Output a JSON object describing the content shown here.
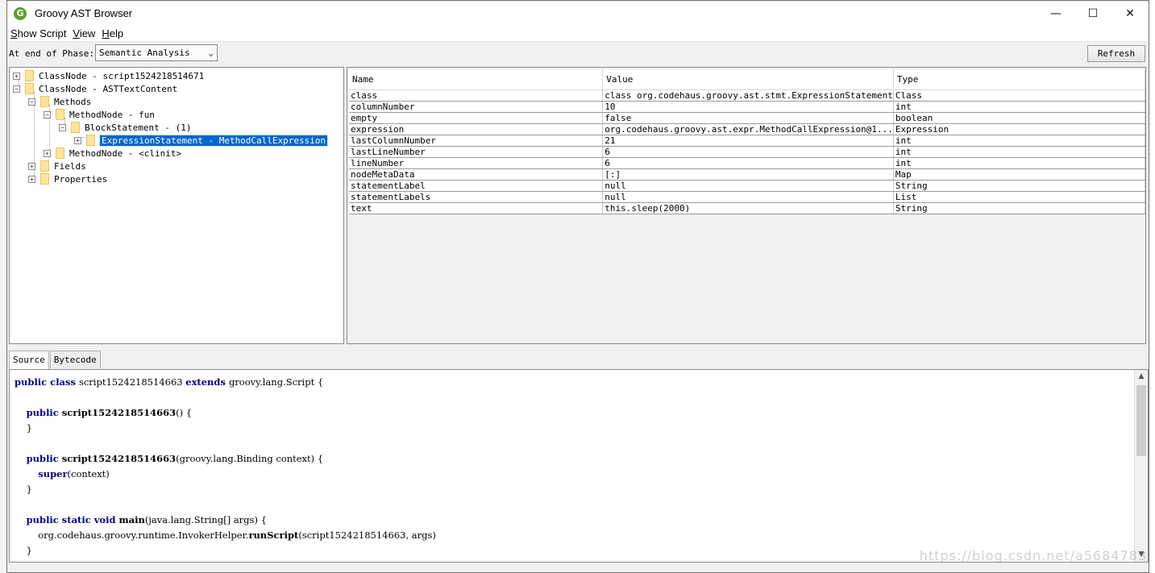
{
  "window": {
    "title": "Groovy AST Browser",
    "icon_letter": "G",
    "controls": {
      "minimize": "—",
      "maximize": "☐",
      "close": "✕"
    }
  },
  "menu": [
    {
      "mnemonic": "S",
      "rest": "how Script"
    },
    {
      "mnemonic": "V",
      "rest": "iew"
    },
    {
      "mnemonic": "H",
      "rest": "elp"
    }
  ],
  "toolbar": {
    "phase_label": "At end of Phase:",
    "phase_value": "Semantic Analysis",
    "refresh_label": "Refresh"
  },
  "tree": [
    {
      "label": "ClassNode - script1524218514671",
      "expander": "+",
      "depth": 0
    },
    {
      "label": "ClassNode - ASTTextContent",
      "expander": "−",
      "depth": 0
    },
    {
      "label": "Methods",
      "expander": "−",
      "depth": 1
    },
    {
      "label": "MethodNode - fun",
      "expander": "−",
      "depth": 2
    },
    {
      "label": "BlockStatement - (1)",
      "expander": "−",
      "depth": 3
    },
    {
      "label": "ExpressionStatement - MethodCallExpression",
      "expander": "+",
      "depth": 4,
      "selected": true
    },
    {
      "label": "MethodNode - <clinit>",
      "expander": "+",
      "depth": 2
    },
    {
      "label": "Fields",
      "expander": "+",
      "depth": 1
    },
    {
      "label": "Properties",
      "expander": "+",
      "depth": 1
    }
  ],
  "properties": {
    "headers": [
      "Name",
      "Value",
      "Type"
    ],
    "rows": [
      [
        "class",
        "class org.codehaus.groovy.ast.stmt.ExpressionStatement",
        "Class"
      ],
      [
        "columnNumber",
        "10",
        "int"
      ],
      [
        "empty",
        "false",
        "boolean"
      ],
      [
        "expression",
        "org.codehaus.groovy.ast.expr.MethodCallExpression@1...",
        "Expression"
      ],
      [
        "lastColumnNumber",
        "21",
        "int"
      ],
      [
        "lastLineNumber",
        "6",
        "int"
      ],
      [
        "lineNumber",
        "6",
        "int"
      ],
      [
        "nodeMetaData",
        "[:]",
        "Map"
      ],
      [
        "statementLabel",
        "null",
        "String"
      ],
      [
        "statementLabels",
        "null",
        "List"
      ],
      [
        "text",
        "this.sleep(2000)",
        "String"
      ]
    ]
  },
  "tabs": [
    "Source",
    "Bytecode"
  ],
  "source_lines": [
    [
      [
        "kw",
        "public class "
      ],
      [
        "t",
        "script1524218514663 "
      ],
      [
        "kw",
        "extends "
      ],
      [
        "t",
        "groovy.lang.Script {"
      ]
    ],
    [],
    [
      [
        "t",
        "    "
      ],
      [
        "kw",
        "public "
      ],
      [
        "fn",
        "script1524218514663"
      ],
      [
        "t",
        "() {"
      ]
    ],
    [
      [
        "t",
        "    }"
      ]
    ],
    [],
    [
      [
        "t",
        "    "
      ],
      [
        "kw",
        "public "
      ],
      [
        "fn",
        "script1524218514663"
      ],
      [
        "t",
        "(groovy.lang.Binding context) {"
      ]
    ],
    [
      [
        "t",
        "        "
      ],
      [
        "kw",
        "super"
      ],
      [
        "t",
        "(context)"
      ]
    ],
    [
      [
        "t",
        "    }"
      ]
    ],
    [],
    [
      [
        "t",
        "    "
      ],
      [
        "kw",
        "public static void "
      ],
      [
        "fn",
        "main"
      ],
      [
        "t",
        "(java.lang.String[] args) {"
      ]
    ],
    [
      [
        "t",
        "        org.codehaus.groovy.runtime.InvokerHelper."
      ],
      [
        "fn",
        "runScript"
      ],
      [
        "t",
        "(script1524218514663, args)"
      ]
    ],
    [
      [
        "t",
        "    }"
      ]
    ]
  ],
  "watermark": "https://blog.csdn.net/a5684783"
}
